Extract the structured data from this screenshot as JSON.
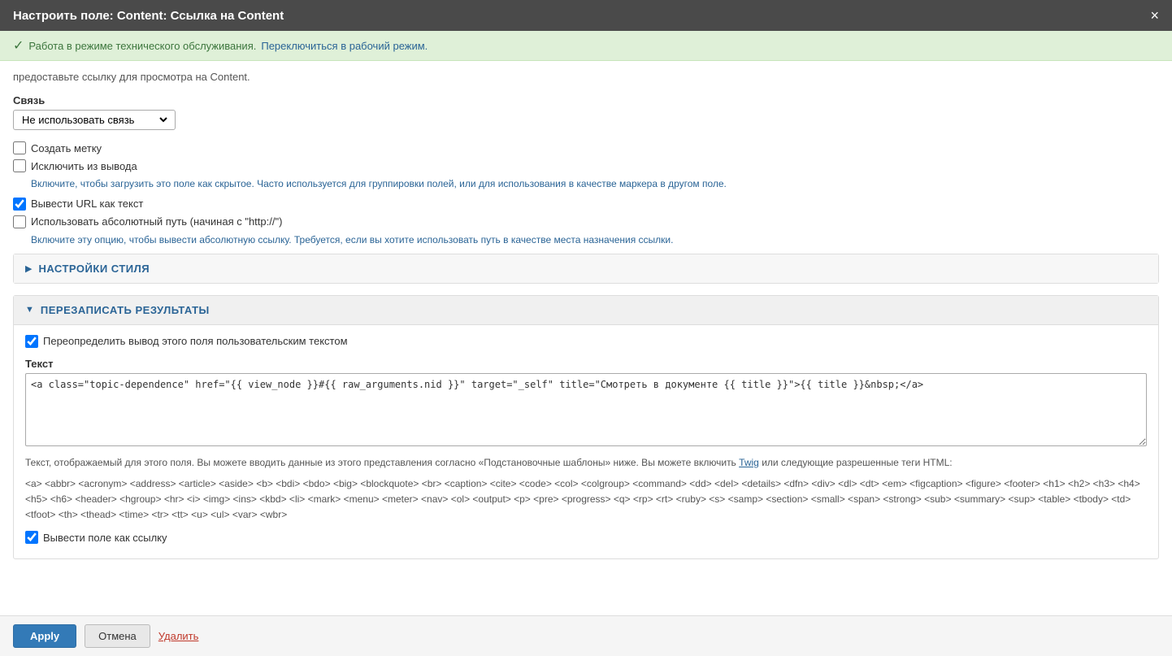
{
  "modal": {
    "title": "Настроить поле: Content: Ссылка на Content",
    "close_label": "×"
  },
  "maintenance": {
    "icon": "✓",
    "text": "Работа в режиме технического обслуживания.",
    "link_text": "Переключиться в рабочий режим.",
    "link_href": "#"
  },
  "intro": {
    "text": "предоставьте ссылку для просмотра на Content."
  },
  "relation_field": {
    "label": "Связь",
    "options": [
      "Не использовать связь"
    ],
    "selected": "Не использовать связь"
  },
  "checkboxes": {
    "create_label_label": "Создать метку",
    "create_label_checked": false,
    "exclude_from_output_label": "Исключить из вывода",
    "exclude_from_output_checked": false,
    "exclude_from_output_help": "Включите, чтобы загрузить это поле как скрытое. Часто используется для группировки полей, или для использования в качестве маркера в другом поле.",
    "output_url_as_text_label": "Вывести URL как текст",
    "output_url_as_text_checked": true,
    "use_absolute_path_label": "Использовать абсолютный путь (начиная с \"http://\")",
    "use_absolute_path_checked": false,
    "use_absolute_path_help": "Включите эту опцию, чтобы вывести абсолютную ссылку. Требуется, если вы хотите использовать путь в качестве места назначения ссылки."
  },
  "style_section": {
    "title": "НАСТРОЙКИ СТИЛЯ",
    "collapsed": true
  },
  "override_section": {
    "title": "ПЕРЕЗАПИСАТЬ РЕЗУЛЬТАТЫ",
    "collapsed": false,
    "override_output_label": "Переопределить вывод этого поля пользовательским текстом",
    "override_output_checked": true,
    "text_label": "Текст",
    "text_value": "<a class=\"topic-dependence\" href=\"{{ view_node }}#{{ raw_arguments.nid }}\" target=\"_self\" title=\"Смотреть в документе {{ title }}\">{{ title }}&nbsp;</a>",
    "help_text_prefix": "Текст, отображаемый для этого поля. Вы можете вводить данные из этого представления согласно «Подстановочные шаблоны» ниже. Вы можете включить",
    "twig_link_text": "Twig",
    "help_text_suffix": "или следующие разрешенные теги HTML:",
    "allowed_tags": "<a> <abbr> <acronym> <address> <article> <aside> <b> <bdi> <bdo> <big> <blockquote> <br> <caption> <cite> <code> <col> <colgroup> <command> <dd> <del> <details> <dfn> <div> <dl> <dt> <em> <figcaption> <figure> <footer> <h1> <h2> <h3> <h4> <h5> <h6> <header> <hgroup> <hr> <i> <img> <ins> <kbd> <li> <mark> <menu> <meter> <nav> <ol> <output> <p> <pre> <progress> <q> <rp> <rt> <ruby> <s> <samp> <section> <small> <span> <strong> <sub> <summary> <sup> <table> <tbody> <td> <tfoot> <th> <thead> <time> <tr> <tt> <u> <ul> <var> <wbr>",
    "output_as_link_label": "Вывести поле как ссылку",
    "output_as_link_checked": true
  },
  "footer": {
    "apply_label": "Apply",
    "cancel_label": "Отмена",
    "delete_label": "Удалить"
  }
}
